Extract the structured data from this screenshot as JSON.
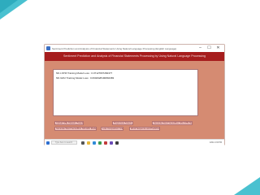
{
  "window": {
    "title": "Sentiment Prediction and Analysis of Financial Statements Using Natural Language Processing (English Language)",
    "controls": {
      "minimize": "–",
      "maximize": "☐",
      "close": "✕"
    }
  },
  "banner": {
    "text": "Sentiment Prediction and Analysis of Financial Statements Processing by Using Natural Language Processing"
  },
  "output": {
    "lines": [
      "NN LSTM Training Model Loss : 0.07127837284377",
      "NN GRU Training Model Loss : 0.0902928190894383"
    ]
  },
  "buttons": {
    "row1": [
      "Upload NSE Dataset (Tweets)",
      "Preprocess Tweets",
      "Generate Word Vector/Run NN LSTM Model"
    ],
    "row2": [
      "Generate Word Vector/Run NN GRU Model",
      "Loss Comparison Graph",
      "Word Sequence and Prediction"
    ]
  },
  "taskbar": {
    "search_placeholder": "Type here to search",
    "tray": "ENG 4:33 PM"
  },
  "colors": {
    "window_bg": "#d58b72",
    "banner": "#a61d1d",
    "accent": "#27b7c9"
  }
}
